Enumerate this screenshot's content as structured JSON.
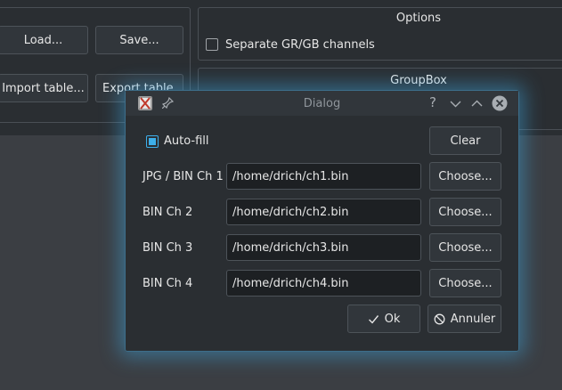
{
  "main": {
    "load_label": "Load...",
    "save_label": "Save...",
    "import_label": "Import table...",
    "export_label": "Export table...",
    "options_title": "Options",
    "separate_channels_label": "Separate GR/GB channels",
    "groupbox_title": "GroupBox"
  },
  "dialog": {
    "title": "Dialog",
    "autofill_label": "Auto-fill",
    "clear_label": "Clear",
    "rows": [
      {
        "label": "JPG / BIN Ch 1",
        "value": "/home/drich/ch1.bin",
        "button": "Choose..."
      },
      {
        "label": "BIN Ch 2",
        "value": "/home/drich/ch2.bin",
        "button": "Choose..."
      },
      {
        "label": "BIN Ch 3",
        "value": "/home/drich/ch3.bin",
        "button": "Choose..."
      },
      {
        "label": "BIN Ch 4",
        "value": "/home/drich/ch4.bin",
        "button": "Choose..."
      }
    ],
    "ok_label": "Ok",
    "cancel_label": "Annuler",
    "help_glyph": "?"
  },
  "colors": {
    "accent": "#3daee9",
    "background": "#2a2e32",
    "button": "#31363b"
  }
}
